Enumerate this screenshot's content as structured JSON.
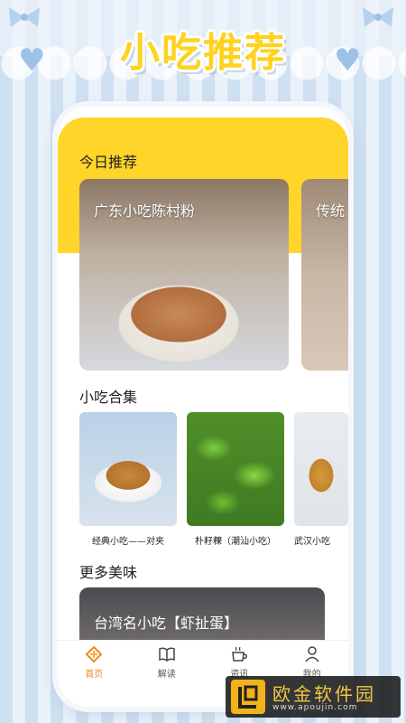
{
  "app_title": "小吃推荐",
  "sections": {
    "today": "今日推荐",
    "collection": "小吃合集",
    "more": "更多美味"
  },
  "recommend_cards": [
    {
      "label": "广东小吃陈村粉"
    },
    {
      "label": "传统"
    }
  ],
  "collection_items": [
    {
      "caption": "经典小吃——对夹"
    },
    {
      "caption": "朴籽粿（潮汕小吃）"
    },
    {
      "caption": "武汉小吃"
    }
  ],
  "more_cards": [
    {
      "label": "台湾名小吃【虾扯蛋】"
    }
  ],
  "tabbar": [
    {
      "label": "首页",
      "icon": "home-icon",
      "active": true
    },
    {
      "label": "解读",
      "icon": "book-icon",
      "active": false
    },
    {
      "label": "资讯",
      "icon": "coffee-cup-icon",
      "active": false
    },
    {
      "label": "我的",
      "icon": "user-icon",
      "active": false
    }
  ],
  "watermark": {
    "name": "欧金软件园",
    "url": "www.apoujin.com"
  },
  "colors": {
    "accent_yellow": "#ffd52a",
    "active_tab": "#f08a1c",
    "title_yellow": "#ffd21f"
  }
}
